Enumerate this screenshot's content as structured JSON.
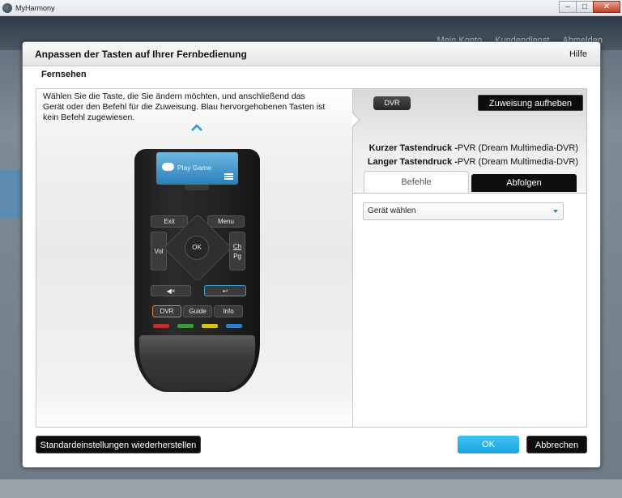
{
  "window": {
    "app_title": "MyHarmony",
    "minimize": "–",
    "maximize": "□",
    "close": "✕"
  },
  "top_nav": [
    "Mein Konto",
    "Kundendienst",
    "Abmelden"
  ],
  "dialog": {
    "title": "Anpassen der Tasten auf Ihrer Fernbedienung",
    "help": "Hilfe",
    "section": "Fernsehen",
    "instruction": "Wählen Sie die Taste, die Sie ändern möchten, und anschließend das Gerät oder den Befehl für die Zuweisung. Blau hervorgehobenen Tasten ist kein Befehl zugewiesen."
  },
  "remote": {
    "screen_label": "Play Game",
    "buttons": {
      "exit": "Exit",
      "menu": "Menu",
      "vol": "Vol",
      "ch_top": "Ch",
      "ch_bottom": "Pg",
      "ok": "OK",
      "dvr": "DVR",
      "guide": "Guide",
      "info": "Info",
      "mute": "◀×",
      "back": "↩"
    },
    "color_buttons": [
      "#c0302a",
      "#3a9a3a",
      "#d8c21e",
      "#2a7fc8"
    ]
  },
  "assignment": {
    "selected_key": "DVR",
    "unassign_button": "Zuweisung aufheben",
    "short_press_label": "Kurzer Tastendruck -",
    "short_press_value": "PVR (Dream Multimedia-DVR)",
    "long_press_label": "Langer Tastendruck -",
    "long_press_value": "PVR (Dream Multimedia-DVR)",
    "tabs": [
      "Befehle",
      "Abfolgen"
    ],
    "device_select_value": "Gerät wählen"
  },
  "footer": {
    "restore_button": "Standardeinstellungen wiederherstellen",
    "ok_button": "OK",
    "cancel_button": "Abbrechen"
  },
  "colors": {
    "accent_blue": "#19a5e0",
    "unassigned_highlight": "#3ba1e0",
    "selected_highlight": "#e87a2a"
  }
}
